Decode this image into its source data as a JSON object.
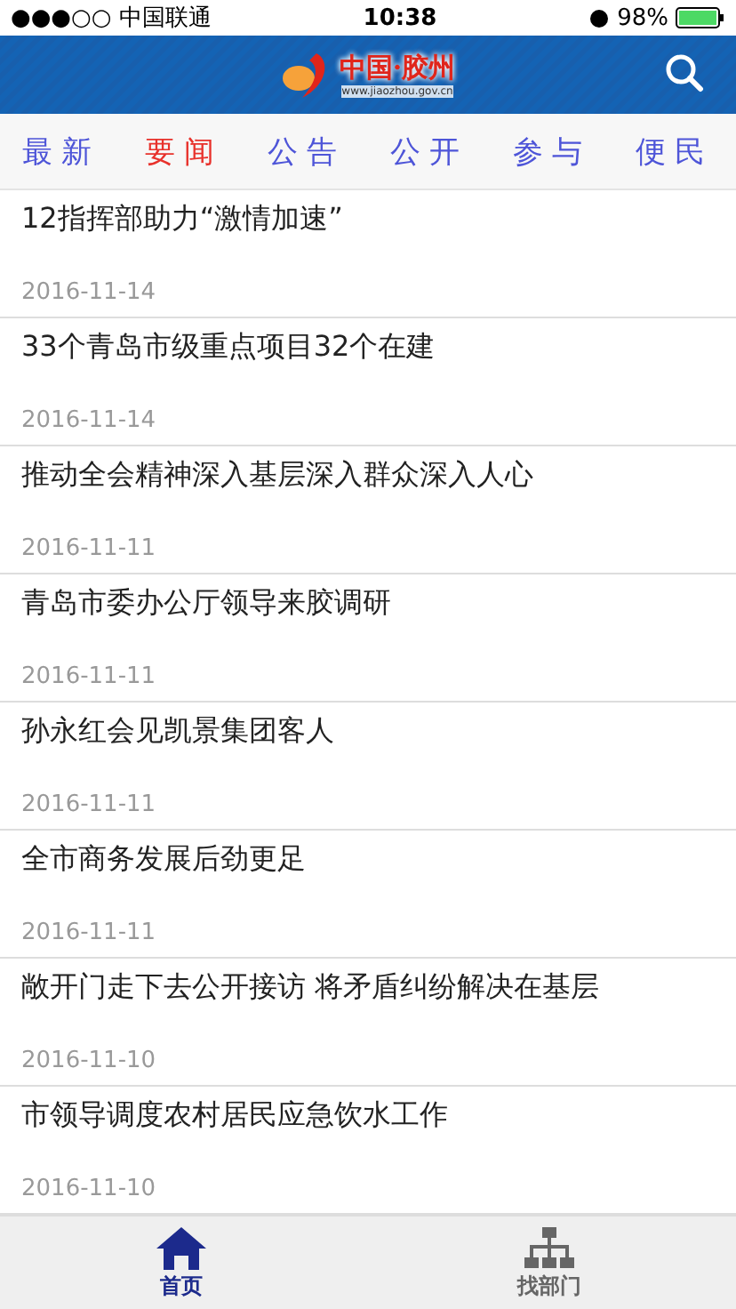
{
  "status_bar": {
    "carrier": "●●●○○ 中国联通",
    "time": "10:38",
    "battery": "98%"
  },
  "header": {
    "logo_title": "中国·胶州",
    "logo_url": "www.jiaozhou.gov.cn"
  },
  "tabs": [
    {
      "label": "最新",
      "selected": false
    },
    {
      "label": "要闻",
      "selected": true
    },
    {
      "label": "公告",
      "selected": false
    },
    {
      "label": "公开",
      "selected": false
    },
    {
      "label": "参与",
      "selected": false
    },
    {
      "label": "便民",
      "selected": false
    }
  ],
  "articles": [
    {
      "title": "12指挥部助力“激情加速”",
      "date": "2016-11-14"
    },
    {
      "title": "33个青岛市级重点项目32个在建",
      "date": "2016-11-14"
    },
    {
      "title": "推动全会精神深入基层深入群众深入人心",
      "date": "2016-11-11"
    },
    {
      "title": "青岛市委办公厅领导来胶调研",
      "date": "2016-11-11"
    },
    {
      "title": "孙永红会见凯景集团客人",
      "date": "2016-11-11"
    },
    {
      "title": "全市商务发展后劲更足",
      "date": "2016-11-11"
    },
    {
      "title": "敞开门走下去公开接访 将矛盾纠纷解决在基层",
      "date": "2016-11-10"
    },
    {
      "title": "市领导调度农村居民应急饮水工作",
      "date": "2016-11-10"
    }
  ],
  "bottom_nav": [
    {
      "label": "首页",
      "kind": "home",
      "selected": true
    },
    {
      "label": "找部门",
      "kind": "org",
      "selected": false
    }
  ]
}
